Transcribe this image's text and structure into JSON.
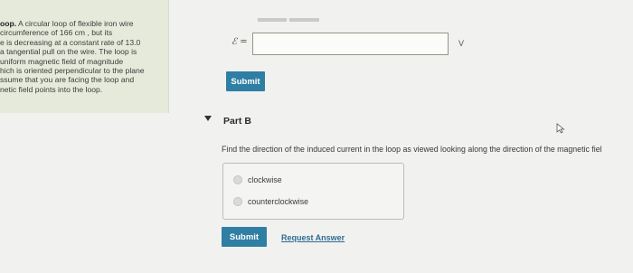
{
  "problem": {
    "text_lead": "oop.",
    "text_body": " A circular loop of flexible iron wire\n circumference of 166 cm , but its\ne is decreasing at a constant rate of 13.0\n a tangential pull on the wire. The loop is\n uniform magnetic field of magnitude\nhich is oriented perpendicular to the plane\nssume that you are facing the loop and\nnetic field points into the loop."
  },
  "part_a": {
    "emf_symbol": "ℰ =",
    "input_value": "",
    "unit": "V",
    "submit_label": "Submit"
  },
  "part_b": {
    "title": "Part B",
    "question": "Find the direction of the induced current in the loop as viewed looking along the direction of the magnetic fiel",
    "options": [
      {
        "label": "clockwise"
      },
      {
        "label": "counterclockwise"
      }
    ],
    "submit_label": "Submit",
    "request_answer_label": "Request Answer"
  },
  "colors": {
    "accent": "#2f7ea3",
    "link": "#2f6c93",
    "left_panel": "#e6eadb",
    "background": "#f1f1ef"
  },
  "icons": {
    "collapse": "triangle-down-icon",
    "cursor": "mouse-pointer-icon"
  }
}
